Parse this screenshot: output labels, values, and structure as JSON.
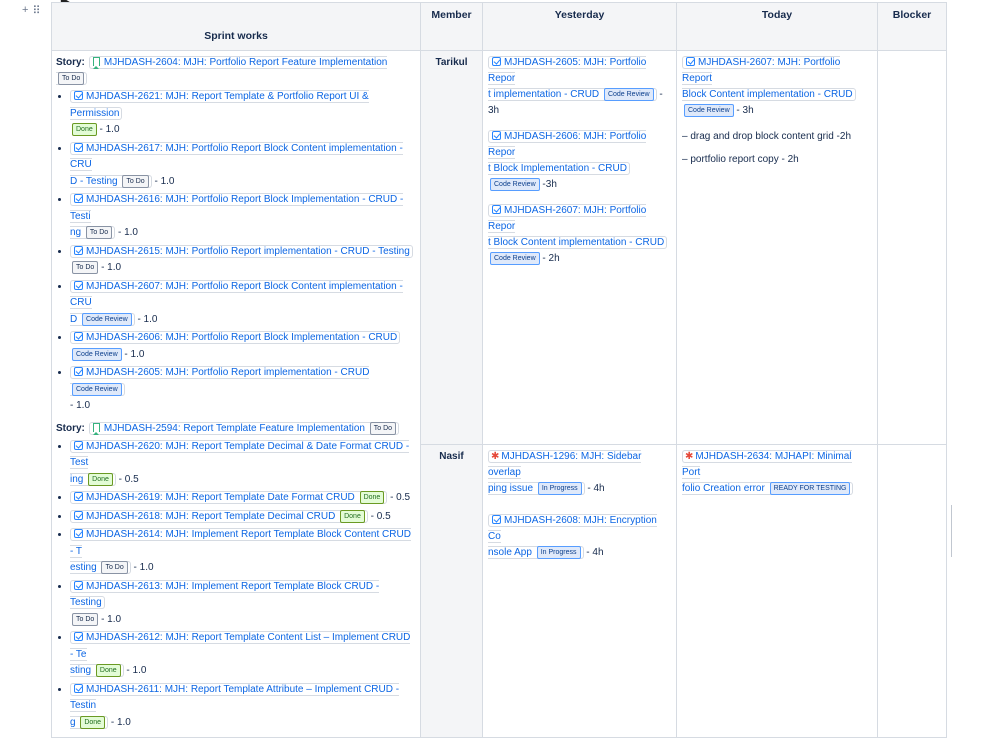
{
  "headers": {
    "sprint": "Sprint works",
    "member": "Member",
    "yesterday": "Yesterday",
    "today": "Today",
    "blocker": "Blocker"
  },
  "story_prefix": "Story:",
  "stories": [
    {
      "link": "MJHDASH-2604: MJH: Portfolio Report Feature Implementation",
      "status": "To Do",
      "items": [
        {
          "link1": "MJHDASH-2621: MJH: Report Template & Portfolio Report UI & Permission",
          "link2": "",
          "status": "Done",
          "est": "- 1.0"
        },
        {
          "link1": "MJHDASH-2617: MJH: Portfolio Report Block Content implementation - CRU",
          "link2": "D - Testing",
          "status": "To Do",
          "est": "- 1.0"
        },
        {
          "link1": "MJHDASH-2616: MJH: Portfolio Report Block Implementation - CRUD - Testi",
          "link2": "ng",
          "status": "To Do",
          "est": "- 1.0"
        },
        {
          "link1": "MJHDASH-2615: MJH: Portfolio Report implementation - CRUD - Testing",
          "link2": "",
          "status": "To Do",
          "est": "- 1.0"
        },
        {
          "link1": "MJHDASH-2607: MJH: Portfolio Report Block Content implementation - CRU",
          "link2": "D",
          "status": "Code Review",
          "est": "- 1.0"
        },
        {
          "link1": "MJHDASH-2606: MJH: Portfolio Report Block Implementation - CRUD",
          "link2": "",
          "status": "Code Review",
          "est": "- 1.0"
        },
        {
          "link1": "MJHDASH-2605: MJH: Portfolio Report implementation - CRUD",
          "link2": "",
          "status": "Code Review",
          "est": "- 1.0"
        }
      ]
    },
    {
      "link": "MJHDASH-2594: Report Template Feature Implementation",
      "status": "To Do",
      "items": [
        {
          "link1": "MJHDASH-2620: MJH: Report Template Decimal & Date Format CRUD - Test",
          "link2": "ing",
          "status": "Done",
          "est": "- 0.5"
        },
        {
          "link1": "MJHDASH-2619: MJH: Report Template Date Format CRUD",
          "link2": "",
          "status": "Done",
          "est": "- 0.5"
        },
        {
          "link1": "MJHDASH-2618: MJH: Report Template Decimal CRUD",
          "link2": "",
          "status": "Done",
          "est": "- 0.5"
        },
        {
          "link1": "MJHDASH-2614: MJH: Implement Report Template Block Content CRUD - T",
          "link2": "esting",
          "status": "To Do",
          "est": "- 1.0"
        },
        {
          "link1": "MJHDASH-2613: MJH: Implement Report Template Block CRUD - Testing",
          "link2": "",
          "status": "To Do",
          "est": "- 1.0"
        },
        {
          "link1": "MJHDASH-2612: MJH: Report Template Content List – Implement CRUD - Te",
          "link2": "sting",
          "status": "Done",
          "est": "- 1.0"
        },
        {
          "link1": "MJHDASH-2611: MJH: Report Template Attribute – Implement CRUD - Testin",
          "link2": "g",
          "status": "Done",
          "est": "- 1.0"
        }
      ]
    }
  ],
  "members": [
    {
      "name": "Tarikul",
      "yesterday": [
        {
          "link1": "MJHDASH-2605: MJH: Portfolio Repor",
          "link2": "t implementation - CRUD",
          "status": "Code Review",
          "est": "-",
          "est2": "3h"
        },
        {
          "link1": "MJHDASH-2606: MJH: Portfolio Repor",
          "link2": "t Block Implementation - CRUD",
          "status": "Code Review",
          "est": "-3h",
          "est2": ""
        },
        {
          "link1": "MJHDASH-2607: MJH: Portfolio Repor",
          "link2": "t Block Content implementation - CRUD",
          "status": "Code Review",
          "est": "- 2h",
          "est2": ""
        }
      ],
      "today": {
        "link1": "MJHDASH-2607: MJH: Portfolio Report",
        "link2": "Block Content implementation - CRUD",
        "status": "Code Review",
        "est": "- 3h",
        "notes": [
          "– drag and drop block content grid -2h",
          "– portfolio report copy - 2h"
        ]
      }
    },
    {
      "name": "Nasif",
      "yesterday": [
        {
          "link1": "MJHDASH-1296: MJH: Sidebar overlap",
          "link2": "ping issue",
          "status": "In Progress",
          "est": "- 4h",
          "bug": true
        },
        {
          "link1": "MJHDASH-2608: MJH: Encryption Co",
          "link2": "nsole App",
          "status": "In Progress",
          "est": "- 4h",
          "bug": false
        }
      ],
      "today": {
        "link1": "MJHDASH-2634: MJHAPI: Minimal Port",
        "link2": "folio Creation error",
        "status": "READY FOR TESTING"
      }
    }
  ]
}
